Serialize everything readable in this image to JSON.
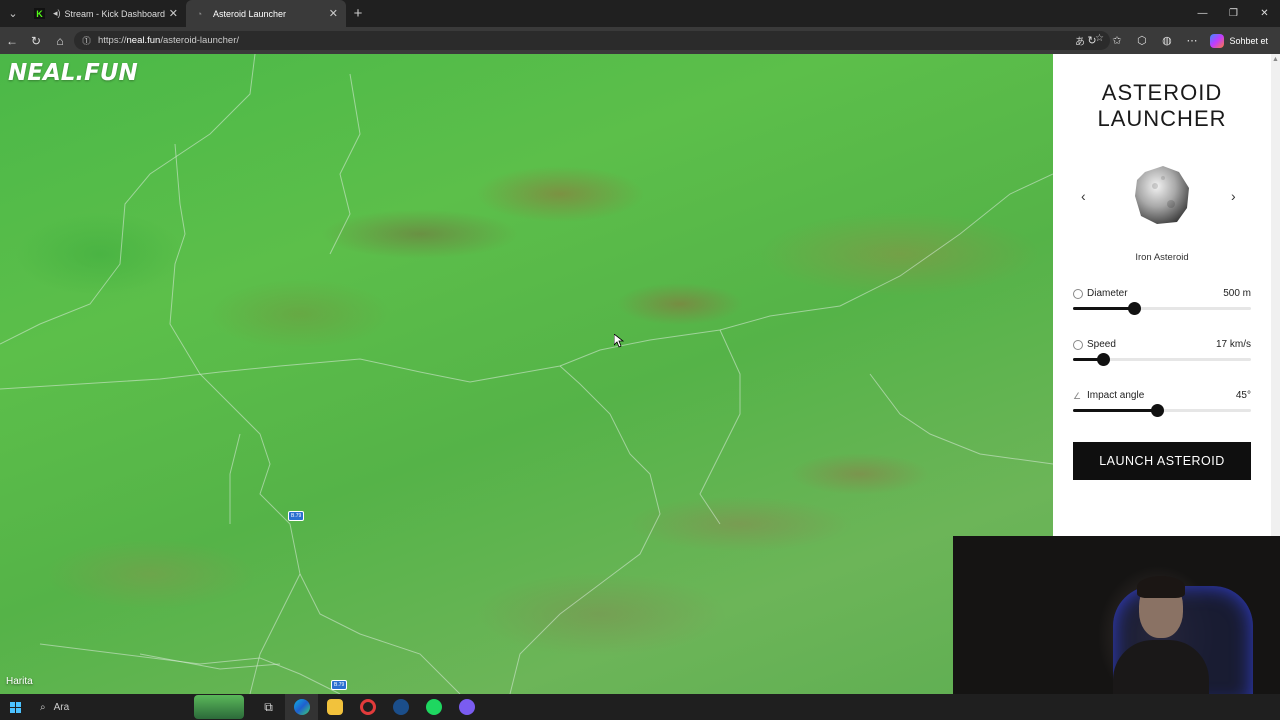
{
  "browser": {
    "tabs": [
      {
        "label": "Stream - Kick Dashboard",
        "favicon": "K"
      },
      {
        "label": "Asteroid Launcher",
        "favicon": ""
      }
    ],
    "url_host": "neal.fun",
    "url_prefix": "https://",
    "url_path": "/asteroid-launcher/",
    "copilot_label": "Sohbet et"
  },
  "page": {
    "brand": "NEAL.FUN",
    "map_attribution": "Harita",
    "road_badge_1": "B.79",
    "road_badge_2": "B.79"
  },
  "sidebar": {
    "title_line1": "ASTEROID",
    "title_line2": "LAUNCHER",
    "asteroid_name": "Iron Asteroid",
    "controls": {
      "diameter": {
        "label": "Diameter",
        "value": "500 m",
        "level": 0.34
      },
      "speed": {
        "label": "Speed",
        "value": "17 km/s",
        "level": 0.17
      },
      "angle": {
        "label": "Impact angle",
        "value": "45°",
        "level": 0.47
      }
    },
    "launch_label": "LAUNCH ASTEROID"
  },
  "taskbar": {
    "search_label": "Ara"
  },
  "colors": {
    "accent": "#111111",
    "browser_bg": "#202020",
    "map_green": "#55b348"
  }
}
